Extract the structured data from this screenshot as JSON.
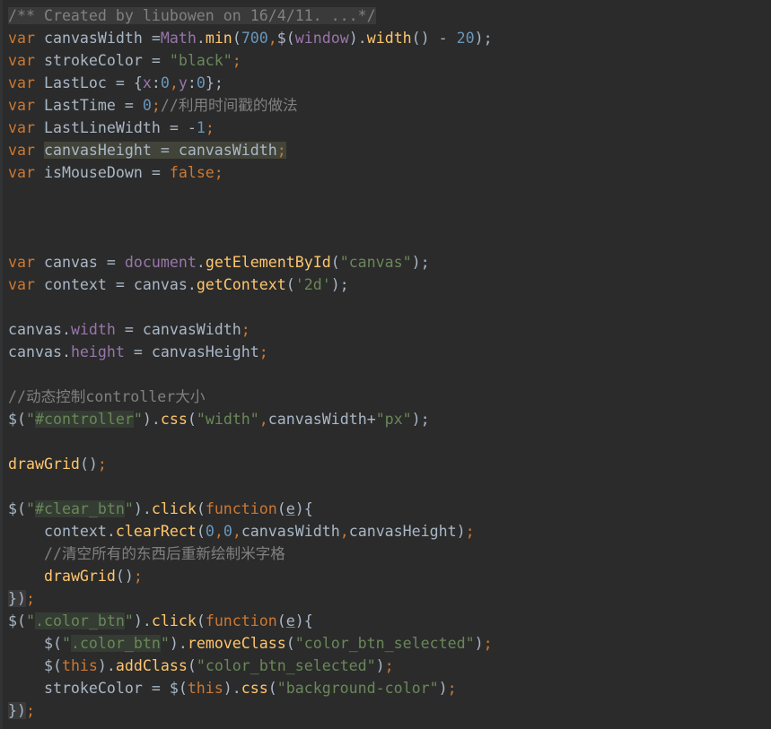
{
  "colors": {
    "background": "#2b2b2b",
    "keyword": "#cc7832",
    "identifier": "#a9b7c6",
    "comment": "#808080",
    "string": "#6a8759",
    "number": "#6897bb",
    "field": "#9876aa",
    "method": "#ffc66d"
  },
  "lines": [
    [
      {
        "t": "/** Created by liubowen on 16/4/11. ...*/",
        "c": "comment fold"
      }
    ],
    [
      {
        "t": "var",
        "c": "kw"
      },
      {
        "t": " canvasWidth =",
        "c": "plain"
      },
      {
        "t": "Math",
        "c": "global"
      },
      {
        "t": ".",
        "c": "plain"
      },
      {
        "t": "min",
        "c": "method"
      },
      {
        "t": "(",
        "c": "plain"
      },
      {
        "t": "700",
        "c": "number"
      },
      {
        "t": ",",
        "c": "kw"
      },
      {
        "t": "$(",
        "c": "plain"
      },
      {
        "t": "window",
        "c": "global"
      },
      {
        "t": ").",
        "c": "plain"
      },
      {
        "t": "width",
        "c": "method"
      },
      {
        "t": "() - ",
        "c": "plain"
      },
      {
        "t": "20",
        "c": "number"
      },
      {
        "t": ");",
        "c": "plain"
      }
    ],
    [
      {
        "t": "var",
        "c": "kw"
      },
      {
        "t": " strokeColor = ",
        "c": "plain"
      },
      {
        "t": "\"black\"",
        "c": "string"
      },
      {
        "t": ";",
        "c": "kw"
      }
    ],
    [
      {
        "t": "var",
        "c": "kw"
      },
      {
        "t": " LastLoc = {",
        "c": "plain"
      },
      {
        "t": "x",
        "c": "field"
      },
      {
        "t": ":",
        "c": "plain"
      },
      {
        "t": "0",
        "c": "number"
      },
      {
        "t": ",",
        "c": "kw"
      },
      {
        "t": "y",
        "c": "field"
      },
      {
        "t": ":",
        "c": "plain"
      },
      {
        "t": "0",
        "c": "number"
      },
      {
        "t": "};",
        "c": "plain"
      }
    ],
    [
      {
        "t": "var",
        "c": "kw"
      },
      {
        "t": " LastTime = ",
        "c": "plain"
      },
      {
        "t": "0",
        "c": "number"
      },
      {
        "t": ";",
        "c": "kw"
      },
      {
        "t": "//利用时间戳的做法",
        "c": "comment"
      }
    ],
    [
      {
        "t": "var",
        "c": "kw"
      },
      {
        "t": " LastLineWidth = -",
        "c": "plain"
      },
      {
        "t": "1",
        "c": "number"
      },
      {
        "t": ";",
        "c": "kw"
      }
    ],
    [
      {
        "t": "var",
        "c": "kw"
      },
      {
        "t": " ",
        "c": "plain"
      },
      {
        "t": "canvasHeight = canvasWidth",
        "c": "plain hl"
      },
      {
        "t": ";",
        "c": "kw hl"
      }
    ],
    [
      {
        "t": "var",
        "c": "kw"
      },
      {
        "t": " isMouseDown = ",
        "c": "plain"
      },
      {
        "t": "false",
        "c": "kw"
      },
      {
        "t": ";",
        "c": "kw"
      }
    ],
    [],
    [],
    [],
    [
      {
        "t": "var",
        "c": "kw"
      },
      {
        "t": " canvas = ",
        "c": "plain"
      },
      {
        "t": "document",
        "c": "global"
      },
      {
        "t": ".",
        "c": "plain"
      },
      {
        "t": "getElementById",
        "c": "method"
      },
      {
        "t": "(",
        "c": "plain"
      },
      {
        "t": "\"canvas\"",
        "c": "string"
      },
      {
        "t": ");",
        "c": "plain"
      }
    ],
    [
      {
        "t": "var",
        "c": "kw"
      },
      {
        "t": " context = canvas.",
        "c": "plain"
      },
      {
        "t": "getContext",
        "c": "method"
      },
      {
        "t": "(",
        "c": "plain"
      },
      {
        "t": "'2d'",
        "c": "string"
      },
      {
        "t": ");",
        "c": "plain"
      }
    ],
    [],
    [
      {
        "t": "canvas.",
        "c": "plain"
      },
      {
        "t": "width",
        "c": "field"
      },
      {
        "t": " = canvasWidth",
        "c": "plain"
      },
      {
        "t": ";",
        "c": "kw"
      }
    ],
    [
      {
        "t": "canvas.",
        "c": "plain"
      },
      {
        "t": "height",
        "c": "field"
      },
      {
        "t": " = canvasHeight",
        "c": "plain"
      },
      {
        "t": ";",
        "c": "kw"
      }
    ],
    [],
    [
      {
        "t": "//动态控制controller大小",
        "c": "comment"
      }
    ],
    [
      {
        "t": "$(",
        "c": "plain"
      },
      {
        "t": "\"",
        "c": "string"
      },
      {
        "t": "#controller",
        "c": "string sel"
      },
      {
        "t": "\"",
        "c": "string"
      },
      {
        "t": ").",
        "c": "plain"
      },
      {
        "t": "css",
        "c": "method"
      },
      {
        "t": "(",
        "c": "plain"
      },
      {
        "t": "\"width\"",
        "c": "string"
      },
      {
        "t": ",",
        "c": "kw"
      },
      {
        "t": "canvasWidth+",
        "c": "plain"
      },
      {
        "t": "\"px\"",
        "c": "string"
      },
      {
        "t": ");",
        "c": "plain"
      }
    ],
    [],
    [
      {
        "t": "drawGrid",
        "c": "method"
      },
      {
        "t": "()",
        "c": "plain"
      },
      {
        "t": ";",
        "c": "kw"
      }
    ],
    [],
    [
      {
        "t": "$(",
        "c": "plain"
      },
      {
        "t": "\"",
        "c": "string"
      },
      {
        "t": "#clear_btn",
        "c": "string sel"
      },
      {
        "t": "\"",
        "c": "string"
      },
      {
        "t": ").",
        "c": "plain"
      },
      {
        "t": "click",
        "c": "method"
      },
      {
        "t": "(",
        "c": "plain"
      },
      {
        "t": "function",
        "c": "kw"
      },
      {
        "t": "(",
        "c": "plain"
      },
      {
        "t": "e",
        "c": "paramu"
      },
      {
        "t": "){",
        "c": "plain"
      }
    ],
    [
      {
        "t": "    context.",
        "c": "plain"
      },
      {
        "t": "clearRect",
        "c": "method"
      },
      {
        "t": "(",
        "c": "plain"
      },
      {
        "t": "0",
        "c": "number"
      },
      {
        "t": ",",
        "c": "kw"
      },
      {
        "t": "0",
        "c": "number"
      },
      {
        "t": ",",
        "c": "kw"
      },
      {
        "t": "canvasWidth",
        "c": "plain"
      },
      {
        "t": ",",
        "c": "kw"
      },
      {
        "t": "canvasHeight)",
        "c": "plain"
      },
      {
        "t": ";",
        "c": "kw"
      }
    ],
    [
      {
        "t": "    //清空所有的东西后重新绘制米字格",
        "c": "comment"
      }
    ],
    [
      {
        "t": "    ",
        "c": "plain"
      },
      {
        "t": "drawGrid",
        "c": "method"
      },
      {
        "t": "()",
        "c": "plain"
      },
      {
        "t": ";",
        "c": "kw"
      }
    ],
    [
      {
        "t": "})",
        "c": "plain fold"
      },
      {
        "t": ";",
        "c": "kw"
      }
    ],
    [
      {
        "t": "$(",
        "c": "plain"
      },
      {
        "t": "\"",
        "c": "string"
      },
      {
        "t": ".color_btn",
        "c": "string sel"
      },
      {
        "t": "\"",
        "c": "string"
      },
      {
        "t": ").",
        "c": "plain"
      },
      {
        "t": "click",
        "c": "method"
      },
      {
        "t": "(",
        "c": "plain"
      },
      {
        "t": "function",
        "c": "kw"
      },
      {
        "t": "(",
        "c": "plain"
      },
      {
        "t": "e",
        "c": "paramu"
      },
      {
        "t": "){",
        "c": "plain"
      }
    ],
    [
      {
        "t": "    $(",
        "c": "plain"
      },
      {
        "t": "\"",
        "c": "string"
      },
      {
        "t": ".color_btn",
        "c": "string sel"
      },
      {
        "t": "\"",
        "c": "string"
      },
      {
        "t": ").",
        "c": "plain"
      },
      {
        "t": "removeClass",
        "c": "method"
      },
      {
        "t": "(",
        "c": "plain"
      },
      {
        "t": "\"color_btn_selected\"",
        "c": "string"
      },
      {
        "t": ")",
        "c": "plain"
      },
      {
        "t": ";",
        "c": "kw"
      }
    ],
    [
      {
        "t": "    $(",
        "c": "plain"
      },
      {
        "t": "this",
        "c": "kw"
      },
      {
        "t": ").",
        "c": "plain"
      },
      {
        "t": "addClass",
        "c": "method"
      },
      {
        "t": "(",
        "c": "plain"
      },
      {
        "t": "\"color_btn_selected\"",
        "c": "string"
      },
      {
        "t": ")",
        "c": "plain"
      },
      {
        "t": ";",
        "c": "kw"
      }
    ],
    [
      {
        "t": "    strokeColor = $(",
        "c": "plain"
      },
      {
        "t": "this",
        "c": "kw"
      },
      {
        "t": ").",
        "c": "plain"
      },
      {
        "t": "css",
        "c": "method"
      },
      {
        "t": "(",
        "c": "plain"
      },
      {
        "t": "\"background-color\"",
        "c": "string"
      },
      {
        "t": ")",
        "c": "plain"
      },
      {
        "t": ";",
        "c": "kw"
      }
    ],
    [
      {
        "t": "})",
        "c": "plain fold"
      },
      {
        "t": ";",
        "c": "kw"
      }
    ]
  ]
}
